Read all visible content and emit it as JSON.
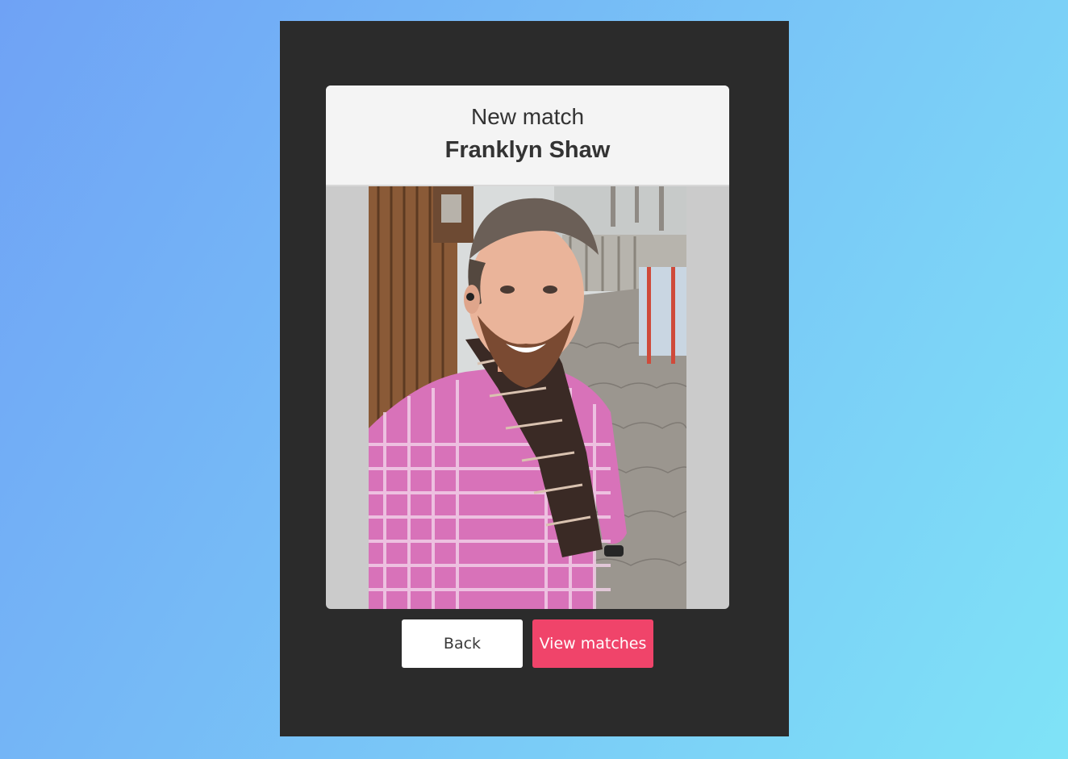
{
  "modal": {
    "subtitle": "New match",
    "match_name": "Franklyn Shaw"
  },
  "photo": {
    "description_icon": "profile-photo"
  },
  "buttons": {
    "back_label": "Back",
    "view_matches_label": "View matches"
  },
  "colors": {
    "background_gradient_start": "#6fa2f5",
    "background_gradient_end": "#7fe3f7",
    "phone_frame": "#2b2b2b",
    "header_bg": "#f4f4f4",
    "accent": "#f0446a"
  }
}
